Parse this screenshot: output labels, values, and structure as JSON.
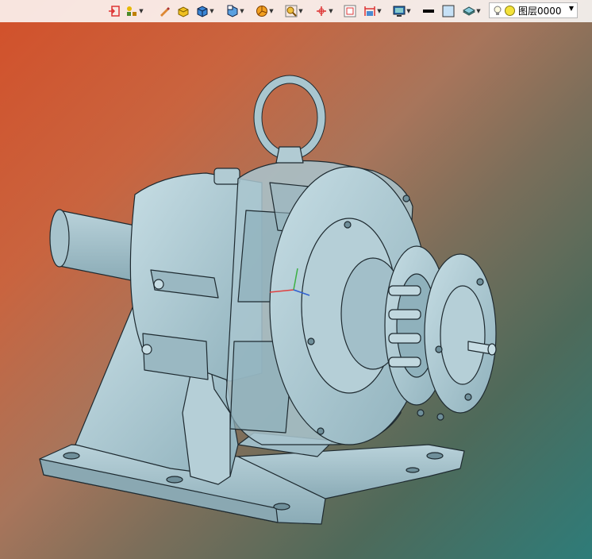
{
  "toolbar": {
    "tools": [
      {
        "name": "exit-sketch-icon",
        "dropdown": false
      },
      {
        "name": "tree-icon",
        "dropdown": true
      },
      {
        "name": "pen-icon",
        "dropdown": false
      },
      {
        "name": "render-style-icon",
        "dropdown": false
      },
      {
        "name": "shaded-cube-icon",
        "dropdown": true
      },
      {
        "name": "view-cube-icon",
        "dropdown": true
      },
      {
        "name": "pie-section-icon",
        "dropdown": true
      },
      {
        "name": "zoom-fit-icon",
        "dropdown": true
      },
      {
        "name": "axis-icon",
        "dropdown": true
      },
      {
        "name": "snap-grid-icon",
        "dropdown": false
      },
      {
        "name": "dimension-icon",
        "dropdown": true
      },
      {
        "name": "monitor-icon",
        "dropdown": true
      },
      {
        "name": "line-color-icon",
        "dropdown": false
      },
      {
        "name": "fill-color-icon",
        "dropdown": false
      },
      {
        "name": "layer-manager-icon",
        "dropdown": true
      }
    ],
    "layer_select": {
      "value": "图层0000"
    }
  },
  "colors": {
    "model_fill": "#a9c6cf",
    "model_shadow": "#7fa0ab",
    "model_light": "#c7dde4",
    "outline": "#1e2a30"
  }
}
